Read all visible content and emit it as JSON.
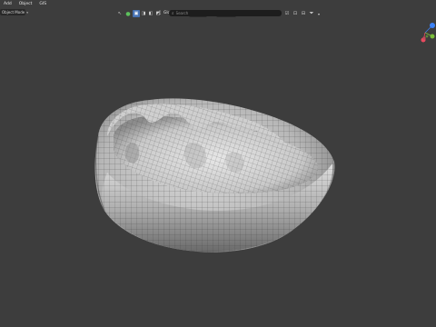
{
  "menubar": {
    "items": [
      {
        "label": "Add"
      },
      {
        "label": "Object"
      },
      {
        "label": "GIS"
      }
    ]
  },
  "mode_selector": {
    "label": "Object Mode",
    "icon": "chevron-down-icon"
  },
  "header": {
    "orientation_label": "Global",
    "search": {
      "placeholder": "Search",
      "value": ""
    }
  },
  "colors": {
    "viewport_bg": "#3d3d3d",
    "active_tool": "#4772b3",
    "axis_x": "#e84a5f",
    "axis_y": "#7bbf3a",
    "axis_z": "#3b82f6"
  }
}
